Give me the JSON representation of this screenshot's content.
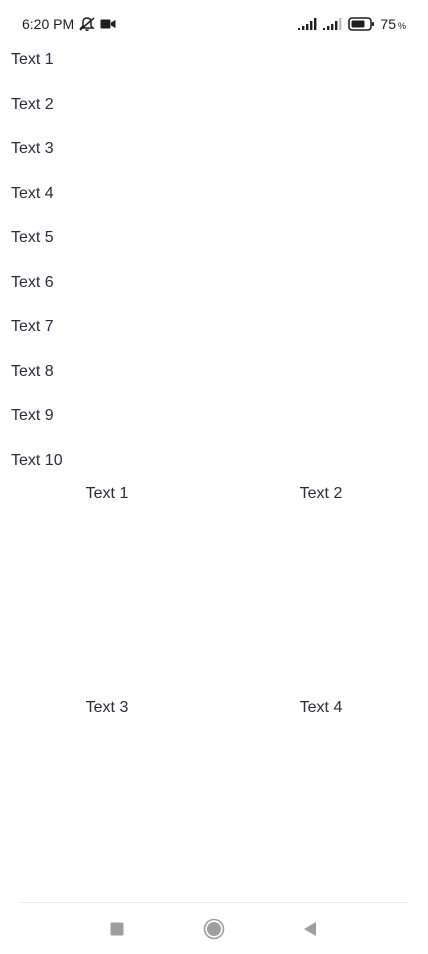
{
  "status_bar": {
    "time": "6:20 PM",
    "battery_percent": "75",
    "battery_percent_sign": "%",
    "icons": [
      "mute-icon",
      "video-camera-icon",
      "signal-icon",
      "signal-icon",
      "battery-icon"
    ]
  },
  "list": {
    "items": [
      "Text 1",
      "Text 2",
      "Text 3",
      "Text 4",
      "Text 5",
      "Text 6",
      "Text 7",
      "Text 8",
      "Text 9",
      "Text 10"
    ]
  },
  "grid": {
    "items": [
      "Text 1",
      "Text 2",
      "Text 3",
      "Text 4"
    ]
  },
  "nav_bar": {
    "buttons": [
      "recents-icon",
      "home-icon",
      "back-icon"
    ]
  },
  "colors": {
    "text": "#2b2b40",
    "nav_icon": "#9e9e9e",
    "background": "#ffffff"
  }
}
